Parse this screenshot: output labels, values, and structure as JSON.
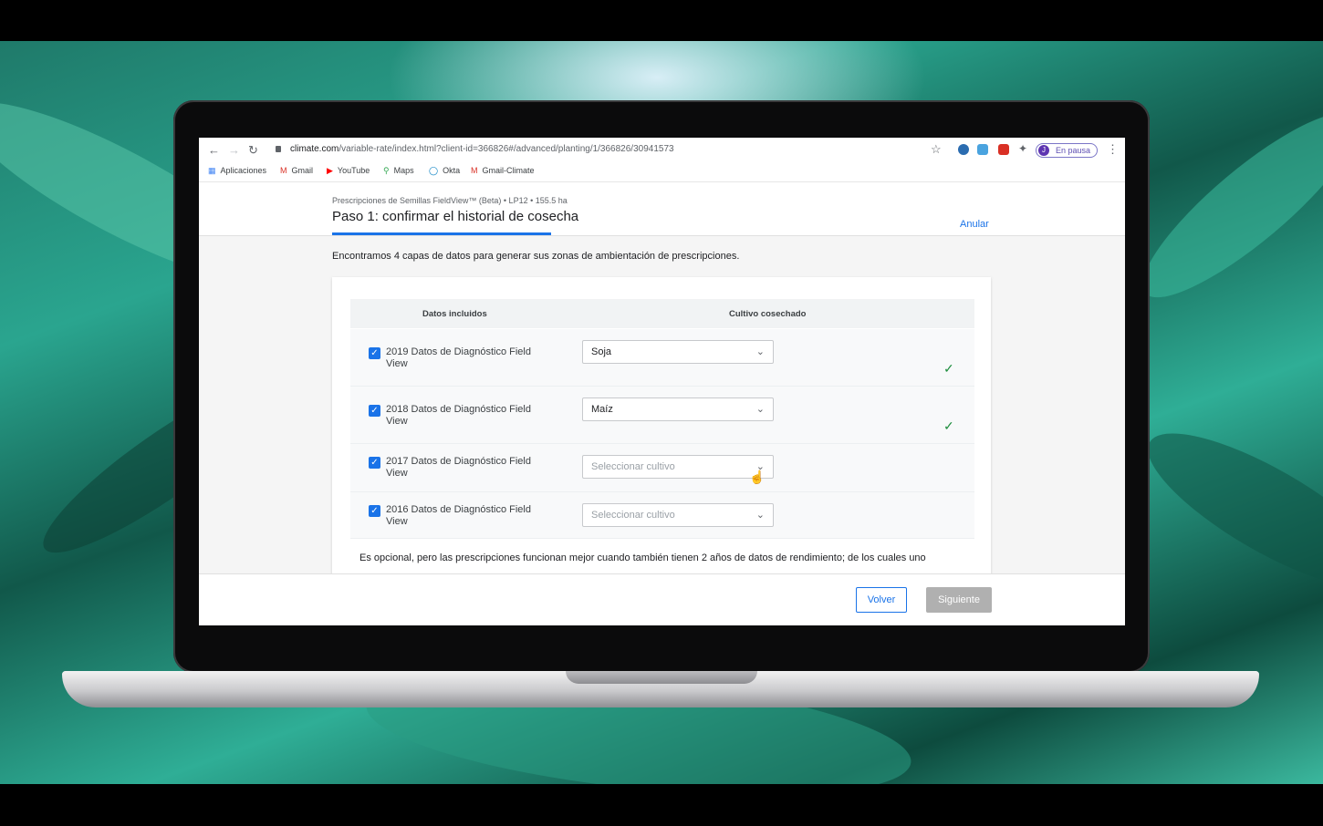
{
  "browser": {
    "url_domain": "climate.com",
    "url_path": "/variable-rate/index.html?client-id=366826#/advanced/planting/1/366826/30941573",
    "profile_initial": "J",
    "profile_status": "En pausa"
  },
  "bookmarks": [
    {
      "label": "Aplicaciones",
      "icon": "apps-grid-icon"
    },
    {
      "label": "Gmail",
      "icon": "gmail-icon"
    },
    {
      "label": "YouTube",
      "icon": "youtube-icon"
    },
    {
      "label": "Maps",
      "icon": "maps-pin-icon"
    },
    {
      "label": "Okta",
      "icon": "okta-icon"
    },
    {
      "label": "Gmail-Climate",
      "icon": "gmail-icon"
    }
  ],
  "header": {
    "subtitle": "Prescripciones de Semillas FieldView™ (Beta) • LP12 • 155.5 ha",
    "title": "Paso 1: confirmar el historial de cosecha",
    "cancel_label": "Anular"
  },
  "main": {
    "intro": "Encontramos 4 capas de datos para generar sus zonas de ambientación de prescripciones.",
    "table": {
      "col_data": "Datos incluidos",
      "col_crop": "Cultivo cosechado",
      "rows": [
        {
          "label": "2019 Datos de Diagnóstico Field View",
          "checked": true,
          "crop": "Soja",
          "placeholder": "",
          "confirmed": true
        },
        {
          "label": "2018 Datos de Diagnóstico Field View",
          "checked": true,
          "crop": "Maíz",
          "placeholder": "",
          "confirmed": true
        },
        {
          "label": "2017 Datos de Diagnóstico Field View",
          "checked": true,
          "crop": "",
          "placeholder": "Seleccionar cultivo",
          "confirmed": false
        },
        {
          "label": "2016 Datos de Diagnóstico Field View",
          "checked": true,
          "crop": "",
          "placeholder": "Seleccionar cultivo",
          "confirmed": false
        }
      ]
    },
    "optional_note": "Es opcional, pero las prescripciones funcionan mejor cuando también tienen 2 años de datos de rendimiento; de los cuales uno"
  },
  "footer": {
    "back_label": "Volver",
    "next_label": "Siguiente"
  },
  "colors": {
    "accent": "#1a73e8",
    "success": "#1e8e3e",
    "disabled_button": "#b0b0b0"
  }
}
